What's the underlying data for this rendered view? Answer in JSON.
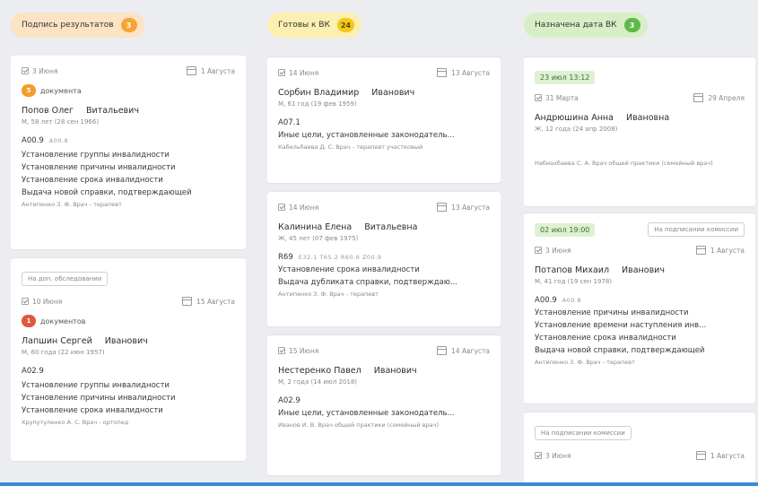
{
  "columns": [
    {
      "title": "Подпись результатов",
      "count": "3",
      "pill_bg": "#fbe3c4",
      "badge_bg": "#f6a436",
      "badge_fg": "#ffffff"
    },
    {
      "title": "Готовы к ВК",
      "count": "24",
      "pill_bg": "#fbefb1",
      "badge_bg": "#f2c81c",
      "badge_fg": "#5a4b00"
    },
    {
      "title": "Назначена дата ВК",
      "count": "3",
      "pill_bg": "#d7efc5",
      "badge_bg": "#5fb84a",
      "badge_fg": "#ffffff"
    }
  ],
  "cards": {
    "c1a": {
      "date_left": "3 Июня",
      "date_right": "1 Августа",
      "docs_count": "5",
      "docs_label": "документа",
      "surname": "Попов Олег",
      "patronymic": "Витальевич",
      "sub": "М, 58 лет (28 сен 1966)",
      "code": "A00.9",
      "code_extra": "A00.8",
      "lines": [
        "Установление группы инвалидности",
        "Установление причины инвалидности",
        "Установление срока инвалидности",
        "Выдача новой справки, подтверждающей"
      ],
      "doctor": "Антипенко З. Ф. Врач - терапевт"
    },
    "c1b": {
      "tag": "На доп. обследовании",
      "date_left": "10 Июня",
      "date_right": "15 Августа",
      "docs_count": "1",
      "docs_label": "документов",
      "surname": "Лапшин Сергей",
      "patronymic": "Иванович",
      "sub": "М, 60 года (22 июн 1957)",
      "code": "A02.9",
      "lines": [
        "Установление группы инвалидности",
        "Установление причины инвалидности",
        "Установление срока инвалидности"
      ],
      "doctor": "Хрупутуленко А. С. Врач - ортопед"
    },
    "c2a": {
      "date_left": "14 Июня",
      "date_right": "13 Августа",
      "surname": "Сорбин Владимир",
      "patronymic": "Иванович",
      "sub": "М, 61 год (19 фев 1959)",
      "code": "A07.1",
      "lines": [
        "Иные цели, установленные законодатель..."
      ],
      "doctor": "Кабельбаева Д. С. Врач - терапевт участковый"
    },
    "c2b": {
      "date_left": "14 Июня",
      "date_right": "13 Августа",
      "surname": "Калинина Елена",
      "patronymic": "Витальевна",
      "sub": "Ж, 45 лет (07 фев 1975)",
      "code": "R69",
      "code_extra": "E32.1 T65.2 R60.6 Z00.9",
      "lines": [
        "Установление срока инвалидности",
        "Выдача дубликата справки, подтверждаю..."
      ],
      "doctor": "Антипенко З. Ф. Врач - терапевт"
    },
    "c2c": {
      "date_left": "15 Июня",
      "date_right": "14 Августа",
      "surname": "Нестеренко Павел",
      "patronymic": "Иванович",
      "sub": "М, 2 года (14 июл 2018)",
      "code": "A02.9",
      "lines": [
        "Иные цели, установленные законодатель..."
      ],
      "doctor": "Иванов И. В. Врач общей практики (семейный врач)"
    },
    "c3a": {
      "date_chip": "23 июл 13:12",
      "date_left": "31 Марта",
      "date_right": "29 Апреля",
      "surname": "Андрюшина Анна",
      "patronymic": "Ивановна",
      "sub": "Ж, 12 года (24 апр 2008)",
      "doctor": "Набиахбаева С. А. Врач общей практики (семейный врач)"
    },
    "c3b": {
      "date_chip": "02 июл 19:00",
      "tag": "На подписании комиссии",
      "date_left": "3 Июня",
      "date_right": "1 Августа",
      "surname": "Потапов Михаил",
      "patronymic": "Иванович",
      "sub": "М, 41 год (19 сен 1978)",
      "code": "A00.9",
      "code_extra": "A00.8",
      "lines": [
        "Установление причины инвалидности",
        "Установление времени наступления инв...",
        "Установление срока инвалидности",
        "Выдача новой справки, подтверждающей"
      ],
      "doctor": "Антипенко З. Ф. Врач - терапевт"
    },
    "c3c": {
      "tag": "На подписании комиссии",
      "date_left": "3 Июня",
      "date_right": "1 Августа"
    }
  }
}
